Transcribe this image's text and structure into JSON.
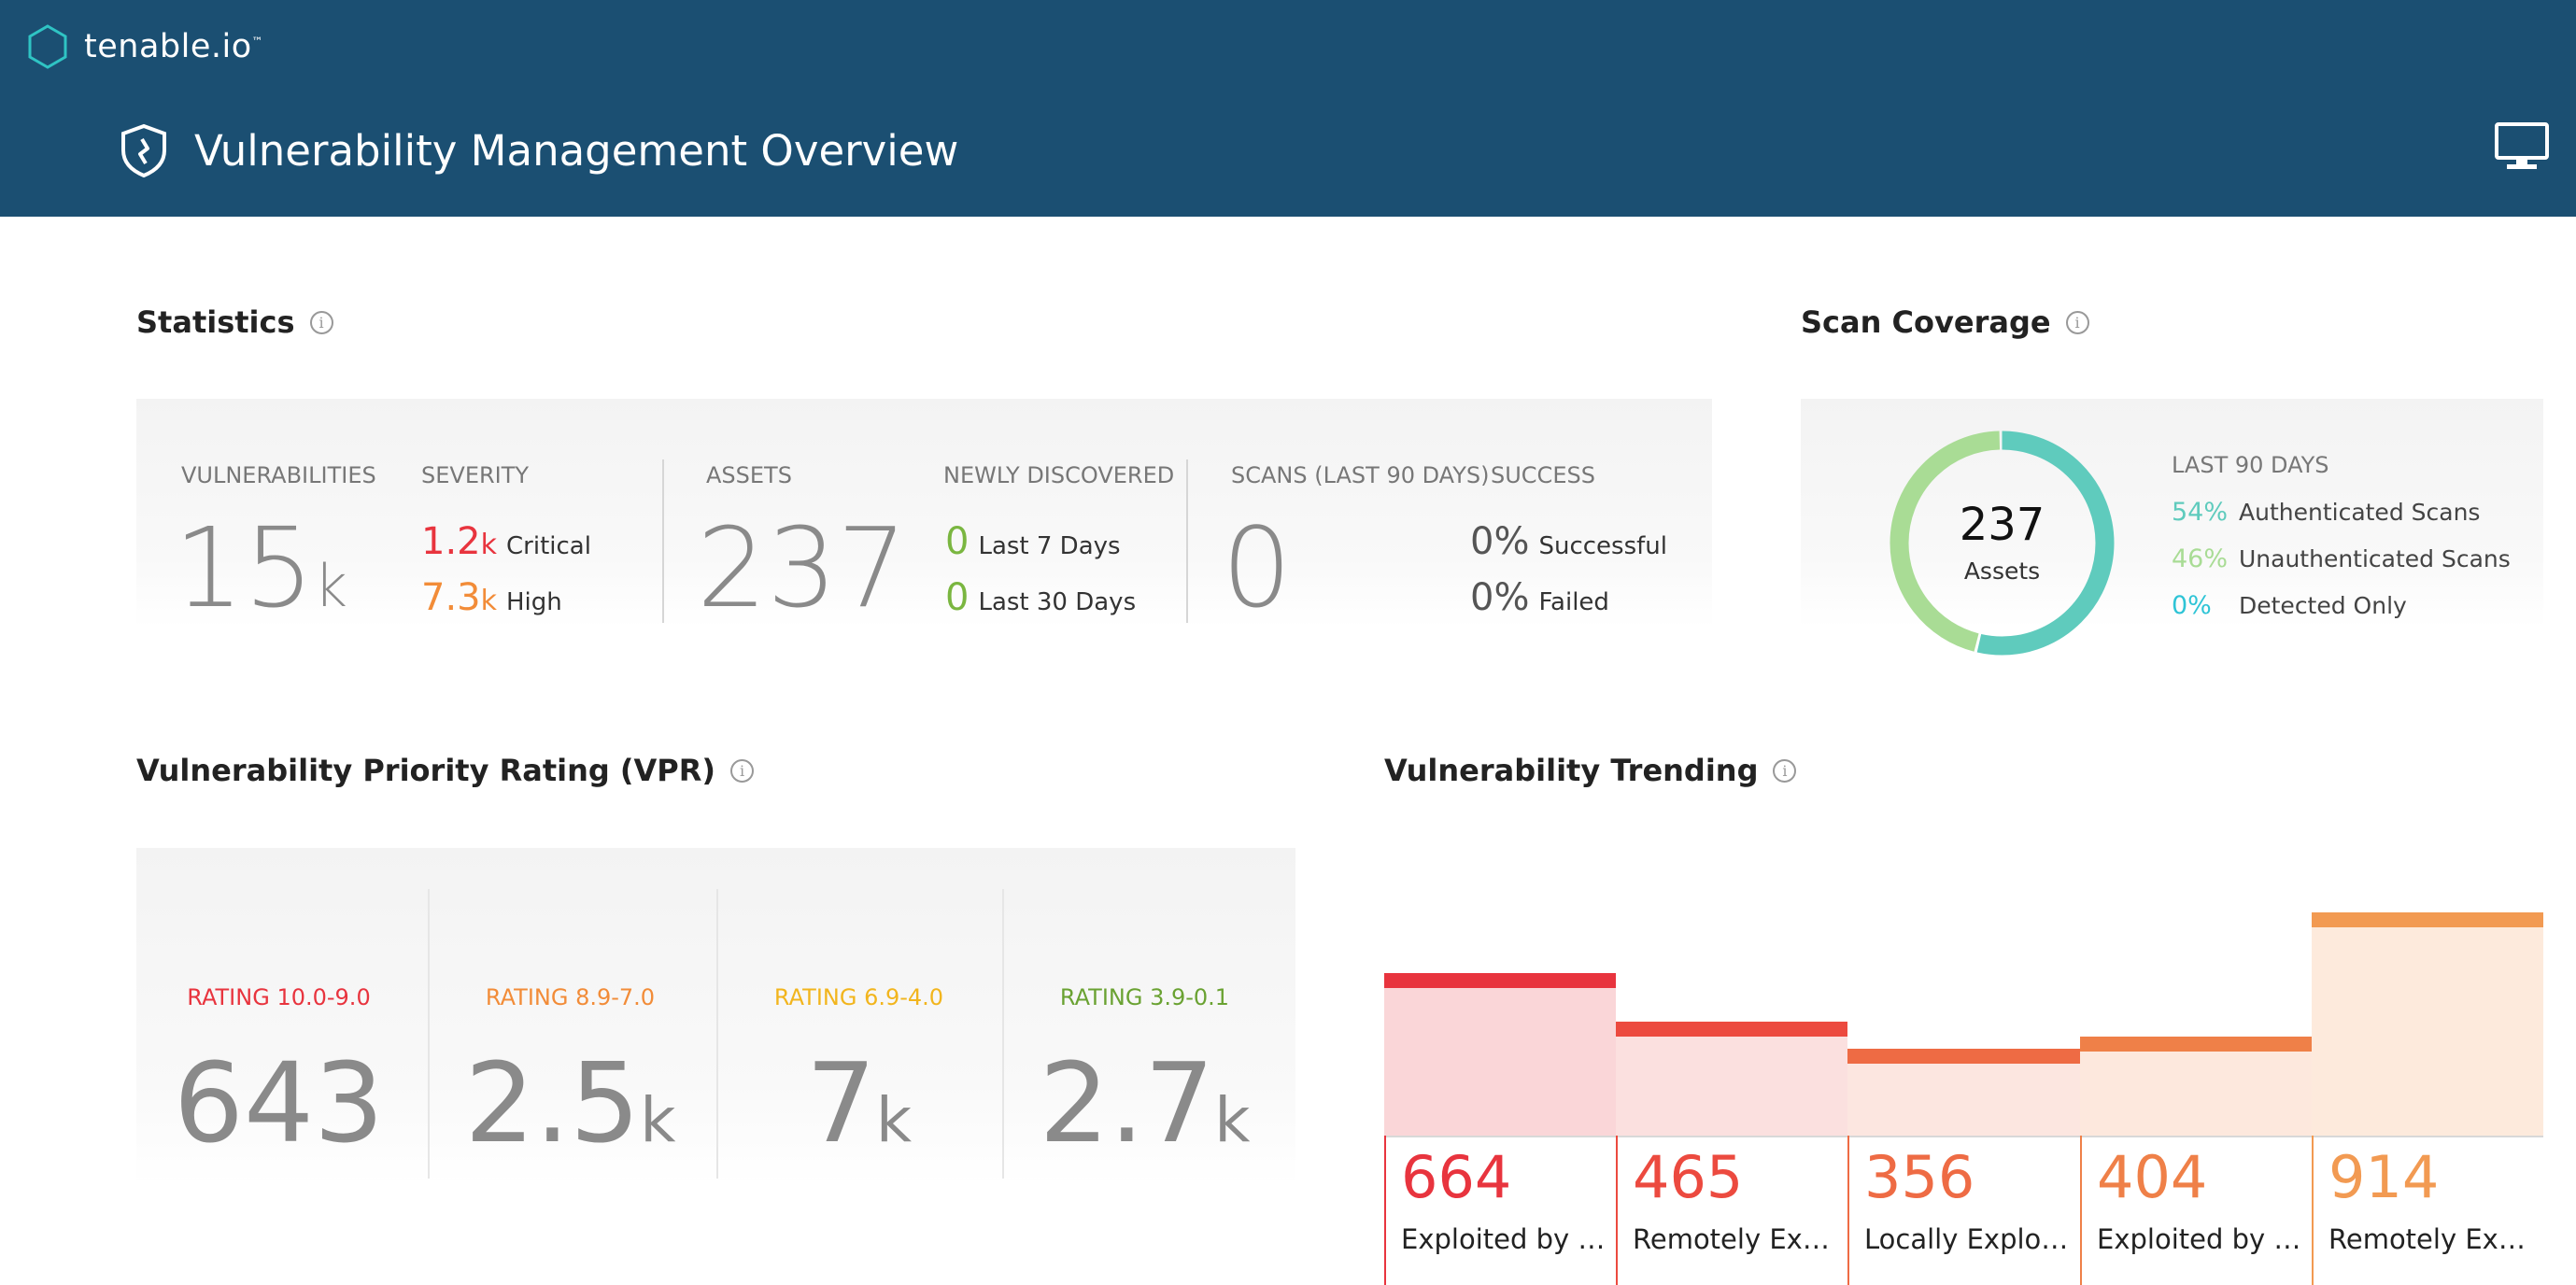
{
  "brand": {
    "name": "tenable.io",
    "tm": "™"
  },
  "header": {
    "title": "Vulnerability Management Overview"
  },
  "statistics": {
    "heading": "Statistics",
    "vulnerabilities": {
      "label": "VULNERABILITIES",
      "value": "15",
      "suffix": "k"
    },
    "severity": {
      "label": "SEVERITY",
      "critical": {
        "value": "1.2",
        "suffix": "k",
        "text": "Critical",
        "color": "#e8343e"
      },
      "high": {
        "value": "7.3",
        "suffix": "k",
        "text": "High",
        "color": "#f28c38"
      }
    },
    "assets": {
      "label": "ASSETS",
      "value": "237"
    },
    "newly_discovered": {
      "label": "NEWLY DISCOVERED",
      "last7": {
        "value": "0",
        "text": "Last 7 Days"
      },
      "last30": {
        "value": "0",
        "text": "Last 30 Days"
      },
      "color": "#7ab640"
    },
    "scans": {
      "label": "SCANS (LAST 90 DAYS)",
      "value": "0"
    },
    "success": {
      "label": "SUCCESS",
      "successful": {
        "value": "0%",
        "text": "Successful"
      },
      "failed": {
        "value": "0%",
        "text": "Failed"
      }
    }
  },
  "scan_coverage": {
    "heading": "Scan Coverage",
    "center_value": "237",
    "center_label": "Assets",
    "period": "LAST 90 DAYS",
    "rows": [
      {
        "pct": "54%",
        "text": "Authenticated Scans",
        "color": "#5fcbbd"
      },
      {
        "pct": "46%",
        "text": "Unauthenticated Scans",
        "color": "#a9dc95"
      },
      {
        "pct": "0%",
        "text": "Detected Only",
        "color": "#2ec4d6"
      }
    ],
    "fractions": [
      0.54,
      0.46,
      0.0
    ]
  },
  "vpr": {
    "heading": "Vulnerability Priority Rating (VPR)",
    "ratings": [
      {
        "label": "RATING 10.0-9.0",
        "value": "643",
        "suffix": "",
        "color": "#e8343e"
      },
      {
        "label": "RATING 8.9-7.0",
        "value": "2.5",
        "suffix": "k",
        "color": "#f28c38"
      },
      {
        "label": "RATING 6.9-4.0",
        "value": "7",
        "suffix": "k",
        "color": "#f2b51d"
      },
      {
        "label": "RATING 3.9-0.1",
        "value": "2.7",
        "suffix": "k",
        "color": "#6aa232"
      }
    ]
  },
  "trending": {
    "heading": "Vulnerability Trending",
    "items": [
      {
        "value": "664",
        "label": "Exploited by Ma...",
        "color": "#e8343e",
        "fill": "#fad6d8",
        "level": 0.664
      },
      {
        "value": "465",
        "label": "Remotely Explo...",
        "color": "#ec4a3f",
        "fill": "#fbe0df",
        "level": 0.465
      },
      {
        "value": "356",
        "label": "Locally Exploita...",
        "color": "#ee6b44",
        "fill": "#fce6e0",
        "level": 0.356
      },
      {
        "value": "404",
        "label": "Exploited by Fra...",
        "color": "#ef8048",
        "fill": "#fde8dd",
        "level": 0.404
      },
      {
        "value": "914",
        "label": "Remotely Explo...",
        "color": "#f29a52",
        "fill": "#fdeadc",
        "level": 0.914
      }
    ]
  },
  "icons": {
    "logo": "hexagon-logo-icon",
    "shield": "shield-icon",
    "monitor": "monitor-icon",
    "info": "info-icon",
    "info_glyph": "i"
  }
}
